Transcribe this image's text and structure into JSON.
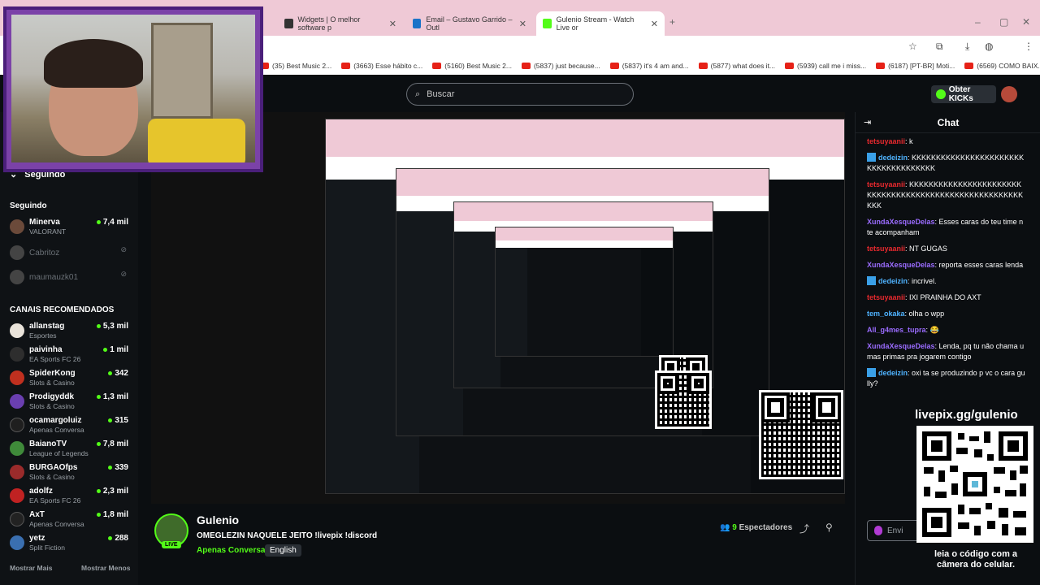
{
  "browser": {
    "tabs": [
      {
        "label": "Widgets | O melhor software p",
        "active": false
      },
      {
        "label": "Email – Gustavo Garrido – Outl",
        "active": false
      },
      {
        "label": "Gulenio Stream - Watch Live or",
        "active": true
      }
    ],
    "bookmarks": [
      "(35) Best Music 2...",
      "(3663) Esse hábito c...",
      "(5160) Best Music 2...",
      "(5837) just because...",
      "(5837) it's 4 am and...",
      "(5877) what does it...",
      "(5939) call me i miss...",
      "(6187) [PT-BR] Moti...",
      "(6569) COMO BAIX..."
    ]
  },
  "header": {
    "search_placeholder": "Buscar",
    "kicks_label": "Obter KICKs"
  },
  "sidebar": {
    "collapse_label": "Seguindo",
    "following_header": "Seguindo",
    "following": [
      {
        "name": "Minerva",
        "category": "VALORANT",
        "viewers": "7,4 mil",
        "online": true,
        "color": "#6b4a3a"
      },
      {
        "name": "Cabritoz",
        "category": "",
        "viewers": "",
        "online": false,
        "color": "#444"
      },
      {
        "name": "maumauzk01",
        "category": "",
        "viewers": "",
        "online": false,
        "color": "#444"
      }
    ],
    "recommended_header": "CANAIS RECOMENDADOS",
    "recommended": [
      {
        "name": "allanstag",
        "category": "Esportes",
        "viewers": "5,3 mil",
        "color": "#e9e3da"
      },
      {
        "name": "paivinha",
        "category": "EA Sports FC 26",
        "viewers": "1 mil",
        "color": "#2e2e2e"
      },
      {
        "name": "SpiderKong",
        "category": "Slots & Casino",
        "viewers": "342",
        "color": "#c0301f"
      },
      {
        "name": "Prodigyddk",
        "category": "Slots & Casino",
        "viewers": "1,3 mil",
        "color": "#6a3fb0"
      },
      {
        "name": "ocamargoluiz",
        "category": "Apenas Conversa",
        "viewers": "315",
        "color": "#1f1f1f"
      },
      {
        "name": "BaianoTV",
        "category": "League of Legends",
        "viewers": "7,8 mil",
        "color": "#3f8a3a"
      },
      {
        "name": "BURGAOfps",
        "category": "Slots & Casino",
        "viewers": "339",
        "color": "#9a2b2b"
      },
      {
        "name": "adolfz",
        "category": "EA Sports FC 26",
        "viewers": "2,3 mil",
        "color": "#c02222"
      },
      {
        "name": "AxT",
        "category": "Apenas Conversa",
        "viewers": "1,8 mil",
        "color": "#222"
      },
      {
        "name": "yetz",
        "category": "Split Fiction",
        "viewers": "288",
        "color": "#3a6fb0"
      }
    ],
    "show_more": "Mostrar Mais",
    "show_less": "Mostrar Menos"
  },
  "stream": {
    "streamer": "Gulenio",
    "live_badge": "LIVE",
    "title": "OMEGLEZIN NAQUELE JEITO !livepix !discord",
    "category": "Apenas Conversa",
    "language": "English",
    "viewers_count": "9",
    "viewers_label": "Espectadores"
  },
  "chat": {
    "title": "Chat",
    "messages": [
      {
        "user": "tetsuyaanii",
        "color": "#e8292e",
        "badge": false,
        "text": "k"
      },
      {
        "user": "dedeizin",
        "color": "#4fb3ff",
        "badge": true,
        "text": "KKKKKKKKKKKKKKKKKKKKKKKKKKKKKKKKKKKKK"
      },
      {
        "user": "tetsuyaanii",
        "color": "#e8292e",
        "badge": false,
        "text": "KKKKKKKKKKKKKKKKKKKKKKKKKKKKKKKKKKKKKKKKKKKKKKKKKKKKKKKKKK"
      },
      {
        "user": "XundaXesqueDelas",
        "color": "#9b6cff",
        "badge": false,
        "text": "Esses caras do teu time n te acompanham"
      },
      {
        "user": "tetsuyaanii",
        "color": "#e8292e",
        "badge": false,
        "text": "NT GUGAS"
      },
      {
        "user": "XundaXesqueDelas",
        "color": "#9b6cff",
        "badge": false,
        "text": "reporta esses caras lenda"
      },
      {
        "user": "dedeizin",
        "color": "#4fb3ff",
        "badge": true,
        "text": "incrivel."
      },
      {
        "user": "tetsuyaanii",
        "color": "#e8292e",
        "badge": false,
        "text": "IXI PRAINHA DO AXT"
      },
      {
        "user": "tem_okaka",
        "color": "#4fb3ff",
        "badge": false,
        "text": "olha o wpp"
      },
      {
        "user": "All_g4mes_tupra",
        "color": "#9b6cff",
        "badge": false,
        "text": "😂"
      },
      {
        "user": "XundaXesqueDelas",
        "color": "#9b6cff",
        "badge": false,
        "text": "Lenda, pq tu não chama umas primas pra jogarem contigo"
      },
      {
        "user": "dedeizin",
        "color": "#4fb3ff",
        "badge": true,
        "text": "oxi ta se produzindo p vc o cara gully?"
      }
    ],
    "input_placeholder": "Envi"
  },
  "overlay": {
    "qr_url_label": "livepix.gg/gulenio",
    "qr_caption_line1": "leia o código com a",
    "qr_caption_line2": "câmera do celular."
  }
}
